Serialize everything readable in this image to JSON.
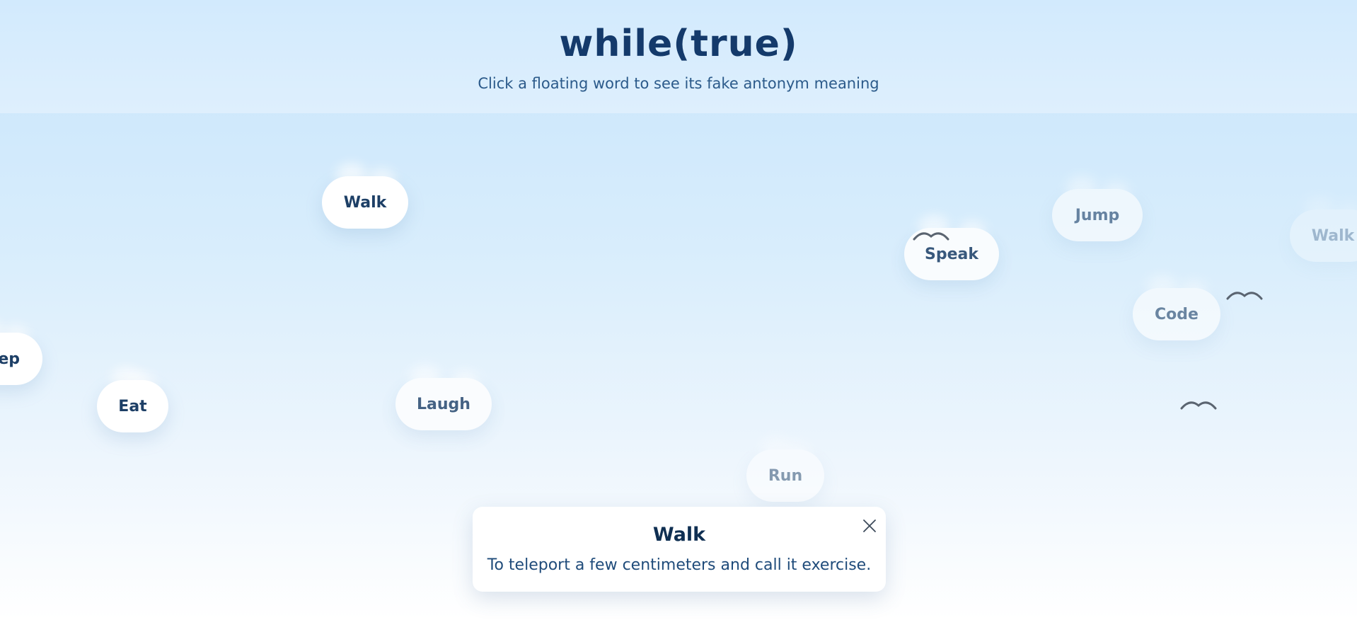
{
  "header": {
    "title": "while(true)",
    "subtitle": "Click a floating word to see its fake antonym meaning"
  },
  "clouds": [
    {
      "label": "Walk"
    },
    {
      "label": "Speak"
    },
    {
      "label": "Jump"
    },
    {
      "label": "Walk"
    },
    {
      "label": "Code"
    },
    {
      "label": "ep"
    },
    {
      "label": "Eat"
    },
    {
      "label": "Laugh"
    },
    {
      "label": "Run"
    }
  ],
  "popup": {
    "title": "Walk",
    "text": "To teleport a few centimeters and call it exercise."
  },
  "icons": {
    "close": "close-icon",
    "bird": "bird-icon"
  }
}
